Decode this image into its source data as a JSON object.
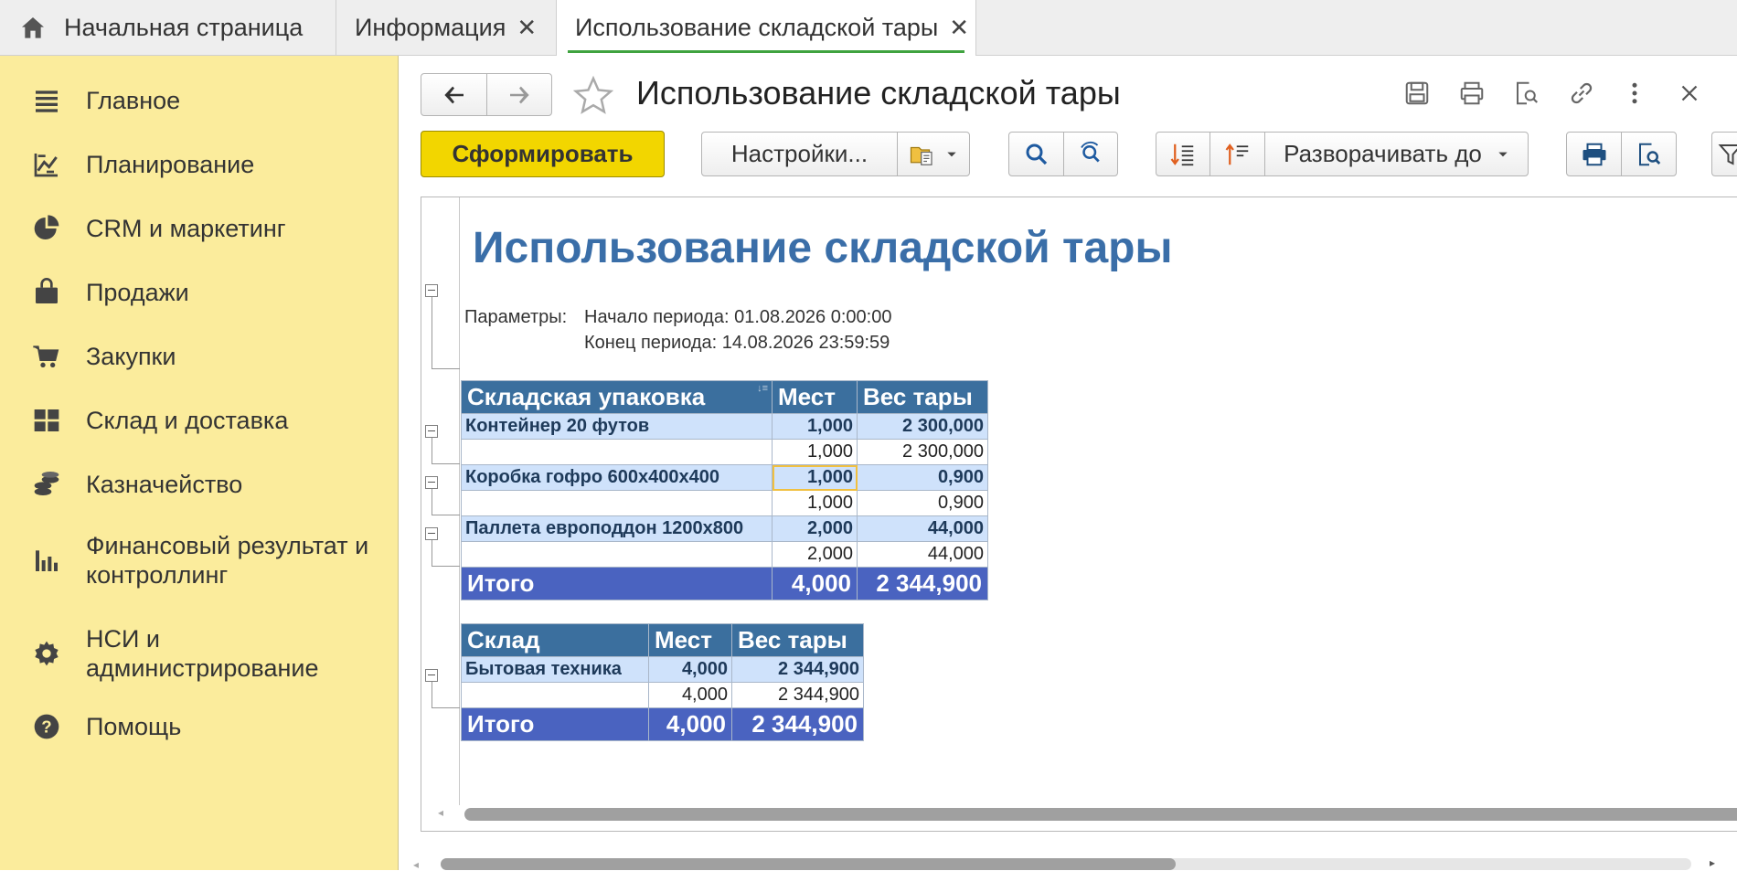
{
  "tabs": [
    {
      "label": "Начальная страница",
      "closable": false
    },
    {
      "label": "Информация",
      "closable": true
    },
    {
      "label": "Использование складской тары",
      "closable": true,
      "active": true
    }
  ],
  "close_glyph": "✕",
  "sidebar": {
    "items": [
      {
        "label": "Главное",
        "icon": "menu-icon"
      },
      {
        "label": "Планирование",
        "icon": "planning-icon"
      },
      {
        "label": "CRM и маркетинг",
        "icon": "pie-chart-icon"
      },
      {
        "label": "Продажи",
        "icon": "shopping-bag-icon"
      },
      {
        "label": "Закупки",
        "icon": "cart-icon"
      },
      {
        "label": "Склад и доставка",
        "icon": "warehouse-grid-icon"
      },
      {
        "label": "Казначейство",
        "icon": "coins-icon"
      },
      {
        "label": "Финансовый результат и",
        "label2": "контроллинг",
        "icon": "bar-chart-icon"
      },
      {
        "label": "НСИ и",
        "label2": "администрирование",
        "icon": "gear-icon"
      },
      {
        "label": "Помощь",
        "icon": "help-icon"
      }
    ]
  },
  "form": {
    "title": "Использование складской тары",
    "generate_button": "Сформировать",
    "settings_button": "Настройки...",
    "expand_button": "Разворачивать до"
  },
  "report": {
    "title": "Использование складской тары",
    "params_label": "Параметры:",
    "period_start": "Начало периода: 01.08.2026 0:00:00",
    "period_end": "Конец периода: 14.08.2026 23:59:59",
    "table1": {
      "headers": [
        "Складская упаковка",
        "Мест",
        "Вес тары"
      ],
      "groups": [
        {
          "name": "Контейнер 20 футов",
          "places": "1,000",
          "weight": "2 300,000",
          "detail_places": "1,000",
          "detail_weight": "2 300,000"
        },
        {
          "name": "Коробка гофро 600х400х400",
          "places": "1,000",
          "weight": "0,900",
          "detail_places": "1,000",
          "detail_weight": "0,900"
        },
        {
          "name": "Паллета европоддон 1200х800",
          "places": "2,000",
          "weight": "44,000",
          "detail_places": "2,000",
          "detail_weight": "44,000"
        }
      ],
      "total_label": "Итого",
      "total_places": "4,000",
      "total_weight": "2 344,900"
    },
    "table2": {
      "headers": [
        "Склад",
        "Мест",
        "Вес тары"
      ],
      "groups": [
        {
          "name": "Бытовая техника",
          "places": "4,000",
          "weight": "2 344,900",
          "detail_places": "4,000",
          "detail_weight": "2 344,900"
        }
      ],
      "total_label": "Итого",
      "total_places": "4,000",
      "total_weight": "2 344,900"
    }
  },
  "colors": {
    "sidebar_bg": "#fbec9c",
    "generate_button": "#f2d600",
    "active_tab_underline": "#3fa33f",
    "report_title": "#3a6ea8",
    "table_header": "#3b6f9e",
    "group_row": "#cfe2fb",
    "total_row": "#4a63c0"
  }
}
